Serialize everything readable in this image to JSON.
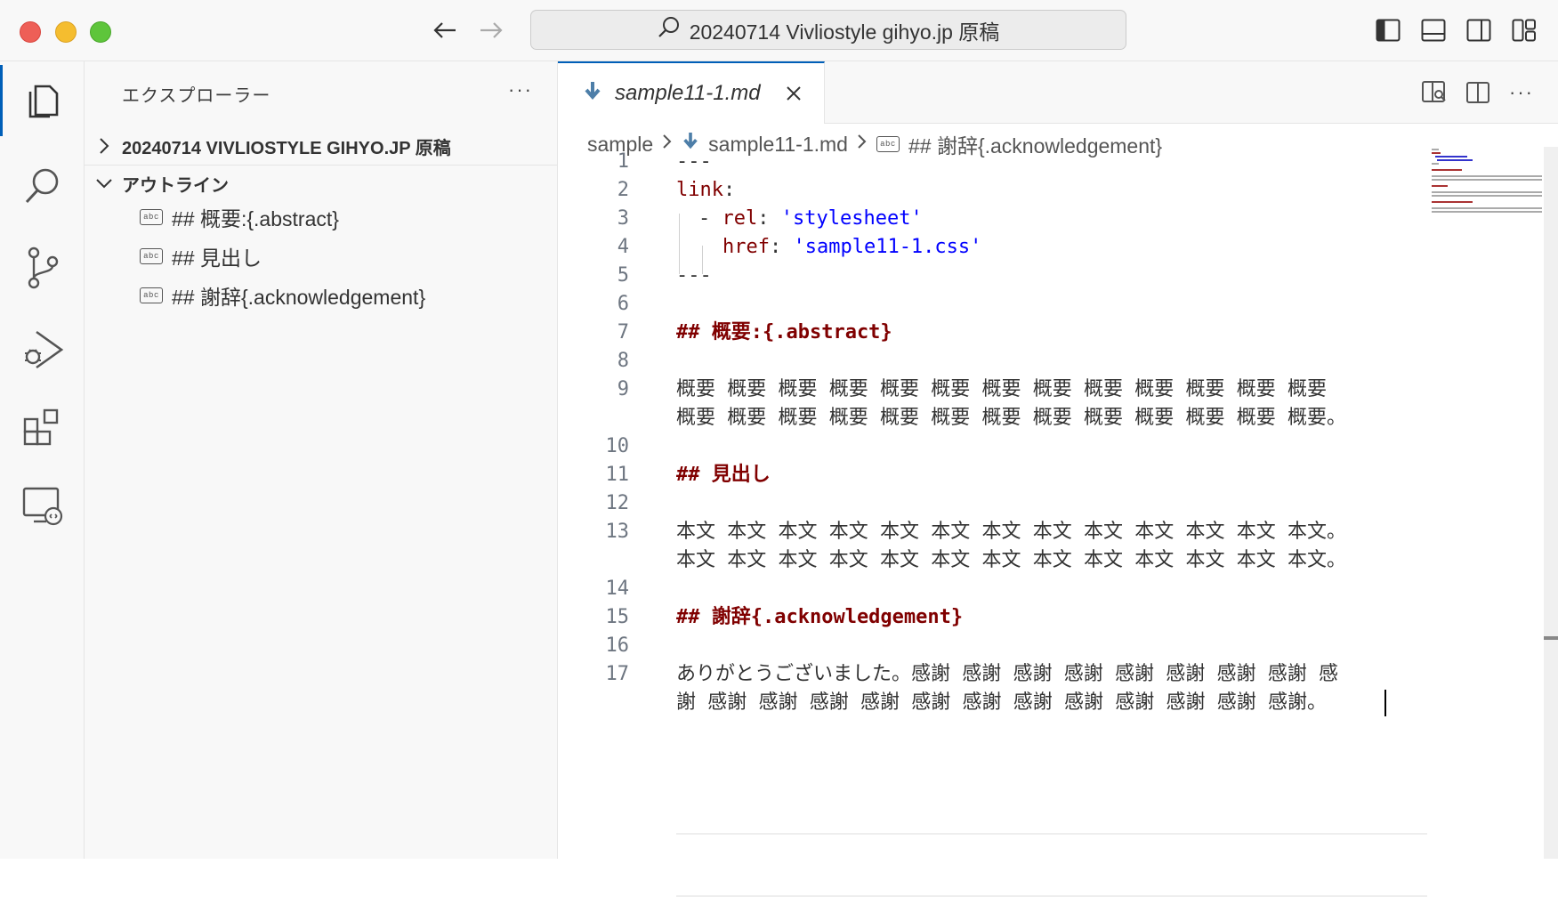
{
  "window": {
    "search_text": "20240714 Vivliostyle gihyo.jp 原稿"
  },
  "sidebar": {
    "title": "エクスプローラー",
    "more": "···",
    "folder_header": "20240714 VIVLIOSTYLE GIHYO.JP 原稿",
    "outline_header": "アウトライン",
    "outline_items": [
      {
        "label": "## 概要:{.abstract}"
      },
      {
        "label": "## 見出し"
      },
      {
        "label": "## 謝辞{.acknowledgement}"
      }
    ]
  },
  "editor": {
    "tab_label": "sample11-1.md",
    "breadcrumb": [
      "sample",
      "sample11-1.md",
      "## 謝辞{.acknowledgement}"
    ],
    "lines": [
      {
        "n": "1",
        "text": "---"
      },
      {
        "n": "2",
        "text": "link:"
      },
      {
        "n": "3",
        "text": "- rel: 'stylesheet'"
      },
      {
        "n": "4",
        "text": "href: 'sample11-1.css'"
      },
      {
        "n": "5",
        "text": "---"
      },
      {
        "n": "6",
        "text": ""
      },
      {
        "n": "7",
        "text": "## 概要:{.abstract}"
      },
      {
        "n": "8",
        "text": ""
      },
      {
        "n": "9",
        "text": "概要 概要 概要 概要 概要 概要 概要 概要 概要 概要 概要 概要 概要"
      },
      {
        "n": "",
        "text": "概要 概要 概要 概要 概要 概要 概要 概要 概要 概要 概要 概要 概要。"
      },
      {
        "n": "10",
        "text": ""
      },
      {
        "n": "11",
        "text": "## 見出し"
      },
      {
        "n": "12",
        "text": ""
      },
      {
        "n": "13",
        "text": "本文 本文 本文 本文 本文 本文 本文 本文 本文 本文 本文 本文 本文。"
      },
      {
        "n": "",
        "text": "本文 本文 本文 本文 本文 本文 本文 本文 本文 本文 本文 本文 本文。"
      },
      {
        "n": "14",
        "text": ""
      },
      {
        "n": "15",
        "text": "## 謝辞{.acknowledgement}"
      },
      {
        "n": "16",
        "text": ""
      },
      {
        "n": "17",
        "text": "ありがとうございました。感謝 感謝 感謝 感謝 感謝 感謝 感謝 感謝 感"
      },
      {
        "n": "",
        "text": "謝 感謝 感謝 感謝 感謝 感謝 感謝 感謝 感謝 感謝 感謝 感謝 感謝。"
      }
    ],
    "yaml": {
      "key_link": "link",
      "dash": "- ",
      "key_rel": "rel",
      "val_rel": "'stylesheet'",
      "key_href": "href",
      "val_href": "'sample11-1.css'",
      "colon": ": "
    }
  },
  "colors": {
    "accent": "#005fb8",
    "heading": "#800000",
    "string": "#0000ff"
  }
}
